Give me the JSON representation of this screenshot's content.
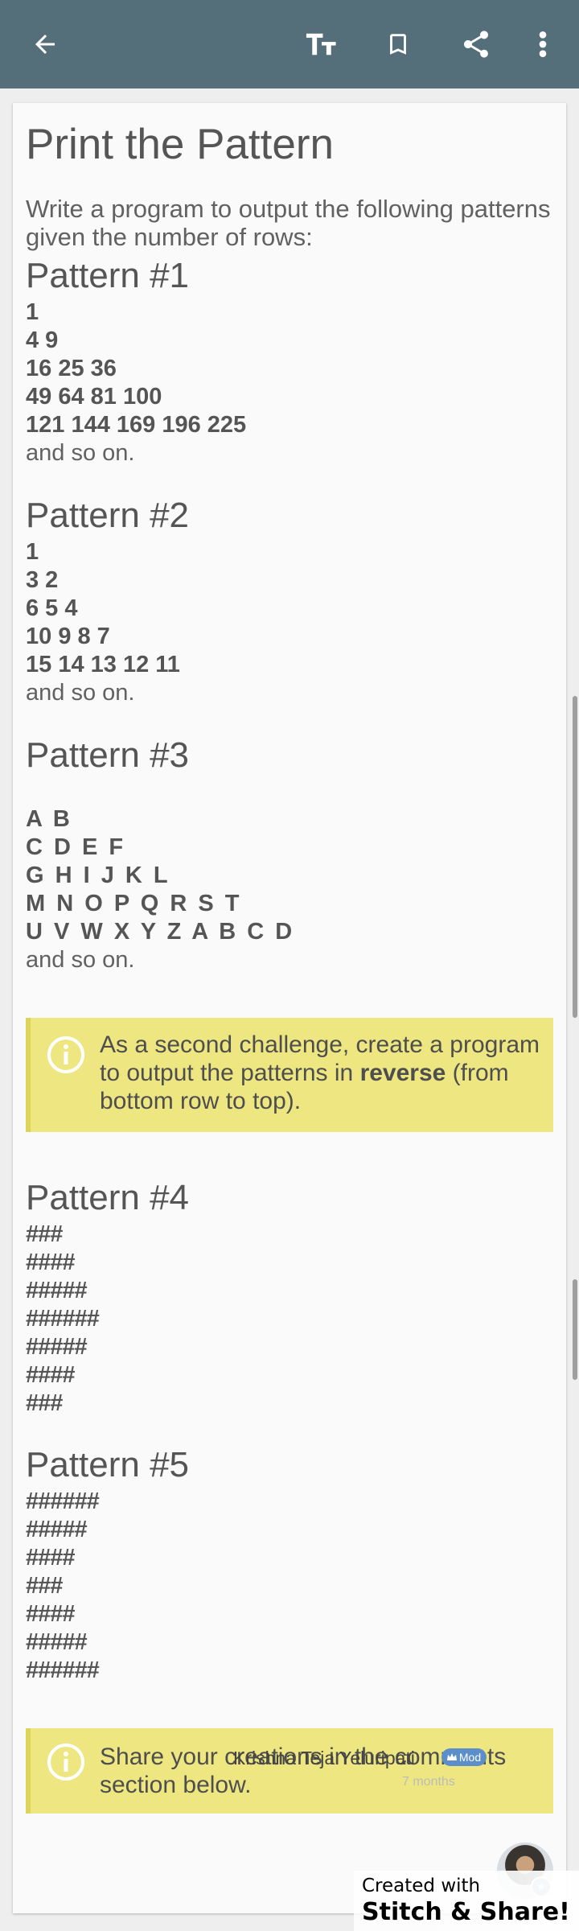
{
  "toolbar": {
    "back_icon": "arrow-left-icon",
    "text_size_icon": "text-size-icon",
    "bookmark_icon": "bookmark-icon",
    "share_icon": "share-icon",
    "more_icon": "more-vertical-icon",
    "color": "#546e7a"
  },
  "lesson": {
    "title": "Print the Pattern",
    "intro": "Write a program to output the following patterns given the number of rows:",
    "patterns": [
      {
        "title": "Pattern #1",
        "lines": [
          "1",
          "4 9",
          "16 25 36",
          "49 64 81 100",
          "121 144 169 196 225"
        ],
        "footer": "and so on."
      },
      {
        "title": "Pattern #2",
        "lines": [
          "1",
          "3 2",
          "6 5 4",
          "10 9 8 7",
          "15 14 13 12 11"
        ],
        "footer": "and so on."
      },
      {
        "title": "Pattern #3",
        "lines": [
          "A B",
          "C D E F",
          "G H I J K L",
          "M N O P Q R S T",
          "U V W X Y Z A B C D"
        ],
        "footer": "and so on."
      },
      {
        "title": "Pattern #4",
        "lines": [
          "###",
          "####",
          "#####",
          "######",
          "#####",
          "####",
          "###"
        ],
        "footer": ""
      },
      {
        "title": "Pattern #5",
        "lines": [
          "######",
          "#####",
          "####",
          "###",
          "####",
          "#####",
          "######"
        ],
        "footer": ""
      }
    ],
    "note1": {
      "before": "As a second challenge, create a program to output the patterns in ",
      "bold": "reverse",
      "after": " (from bottom row to top)."
    },
    "note2": "Share your creations in the comments section below.",
    "note_color": "#eee781"
  },
  "author": {
    "name": "Krishna Teja Yeluripati",
    "badge": "Mod",
    "subtitle": "7 months"
  },
  "watermark": {
    "line1": "Created with",
    "line2": "Stitch & Share!"
  }
}
